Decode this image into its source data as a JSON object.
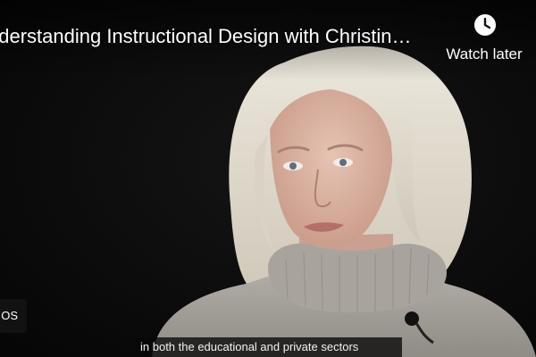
{
  "video": {
    "title": "nderstanding Instructional Design with Christin…",
    "caption": "in both the educational and private sectors"
  },
  "controls": {
    "watch_later_label": "Watch later",
    "watch_later_icon": "clock-icon",
    "more_videos_label": "OS"
  },
  "colors": {
    "background": "#070707",
    "text": "#ffffff",
    "sweater": "#a9a6a0",
    "hair": "#e2ddd2"
  }
}
